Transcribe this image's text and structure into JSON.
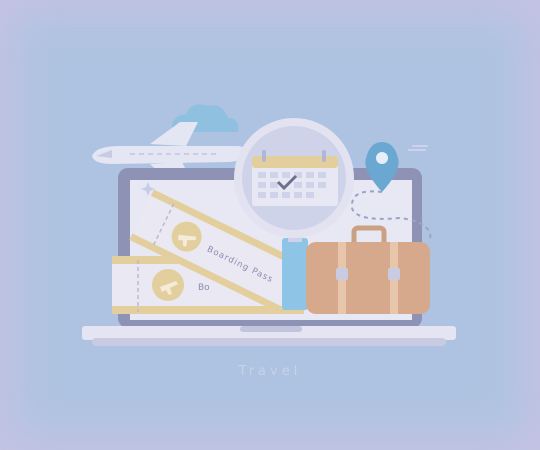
{
  "illustration": {
    "subject": "travel",
    "icons": [
      "airplane-icon",
      "cloud-icon",
      "map-pin-icon",
      "magnifier-icon",
      "calendar-icon",
      "laptop-icon",
      "boarding-pass-icon",
      "suitcase-icon"
    ],
    "ticket_front_text": "Boarding Pass",
    "ticket_back_text": "Bo",
    "caption": "Travel"
  },
  "colors": {
    "background": "#aec3e1",
    "vignette": "#c3c3e3",
    "laptop": "#8e92b4",
    "screen": "#e8e8f4",
    "ticket": "#eae8f2",
    "ticket_accent": "#e3cf9e",
    "suitcase": "#d6a98c",
    "cloud": "#8fc0e0",
    "pin": "#6aa8d2",
    "magnifier_handle": "#8ec4e6"
  }
}
